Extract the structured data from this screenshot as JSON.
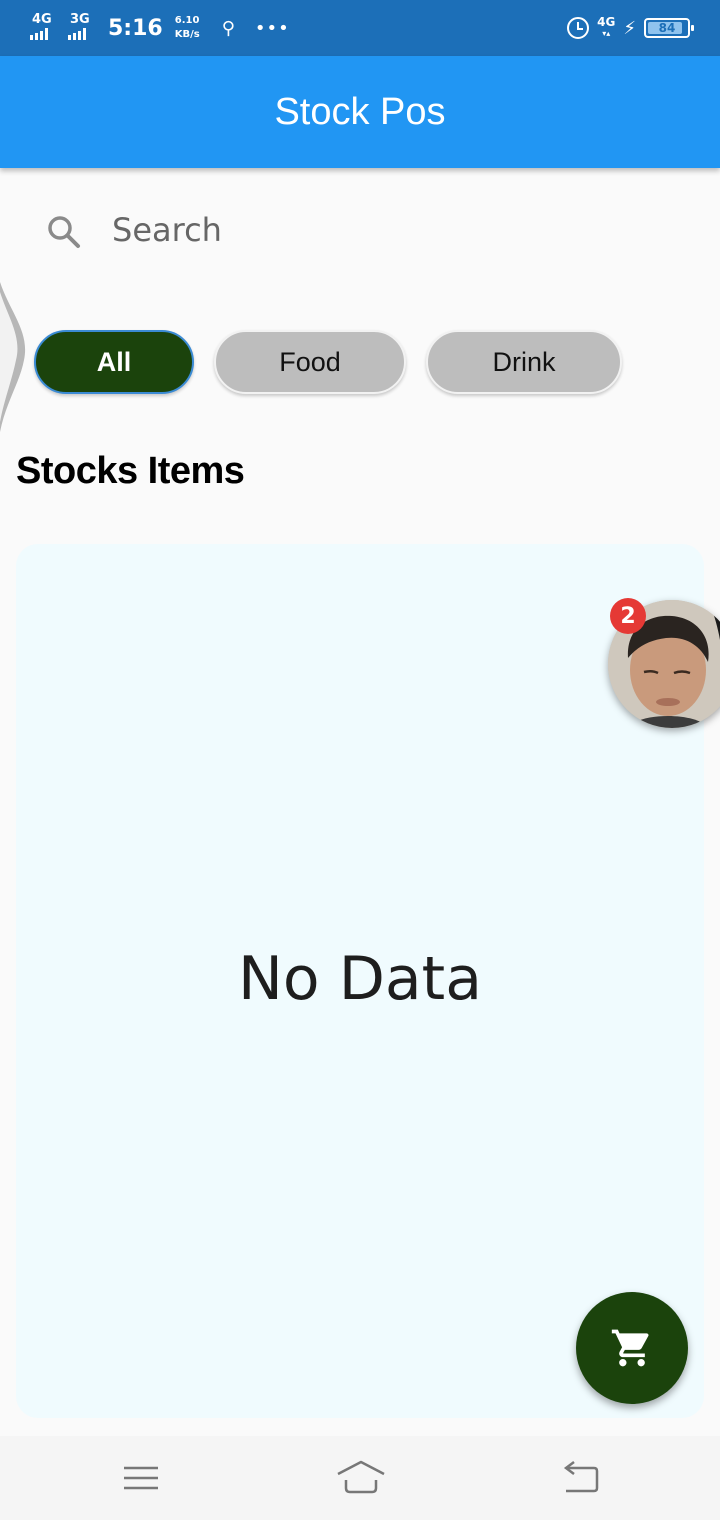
{
  "status_bar": {
    "net1": "4G",
    "net2": "3G",
    "time": "5:16",
    "speed_value": "6.10",
    "speed_unit": "KB/s",
    "net_right": "4G",
    "battery": "84"
  },
  "app_bar": {
    "title": "Stock Pos"
  },
  "search": {
    "placeholder": "Search"
  },
  "categories": [
    {
      "label": "All",
      "selected": true
    },
    {
      "label": "Food",
      "selected": false
    },
    {
      "label": "Drink",
      "selected": false
    }
  ],
  "section": {
    "title": "Stocks Items"
  },
  "items": {
    "empty_text": "No Data"
  },
  "chat_head": {
    "badge_count": "2"
  },
  "colors": {
    "app_bar": "#2196f3",
    "status_bar": "#1c6fb8",
    "selected_chip": "#1b430c",
    "unselected_chip": "#bdbdbd",
    "fab": "#1b430c",
    "badge": "#e53935"
  },
  "icons": {
    "search": "search-icon",
    "fab": "cart-icon",
    "nav": [
      "menu-icon",
      "home-icon",
      "back-icon"
    ]
  }
}
